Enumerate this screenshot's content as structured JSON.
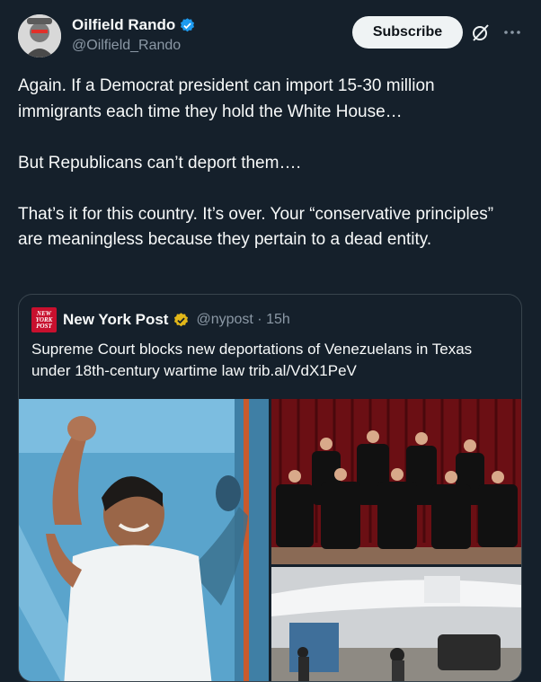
{
  "author": {
    "display_name": "Oilfield Rando",
    "handle": "@Oilfield_Rando"
  },
  "actions": {
    "subscribe_label": "Subscribe",
    "icons": [
      "grok-icon",
      "more-icon"
    ]
  },
  "tweet": {
    "paragraphs": [
      "Again. If a Democrat president can import 15-30 million immigrants each time they hold the White House…",
      "But Republicans can’t deport them….",
      "That’s it for this country. It’s over. Your “conservative principles” are meaningless because they pertain to a dead entity."
    ]
  },
  "quote": {
    "logo_lines": [
      "NEW",
      "YORK",
      "POST"
    ],
    "source_name": "New York Post",
    "handle_time": "@nypost · 15h",
    "text": "Supreme Court blocks new deportations of Venezuelans in Texas under 18th-century wartime law trib.al/VdX1PeV"
  },
  "colors": {
    "background": "#15202b",
    "verified_blue": "#1d9bf0",
    "verified_gold": "#e2b719",
    "muted": "#8b98a5"
  }
}
